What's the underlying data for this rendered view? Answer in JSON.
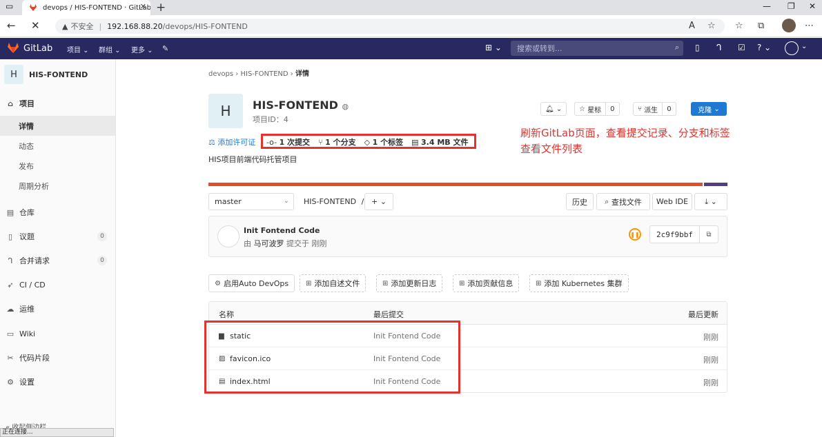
{
  "browser": {
    "tab_title": "devops / HIS-FONTEND · GitLab",
    "tab_close": "✕",
    "new_tab": "+",
    "security_label": "不安全",
    "url_host": "192.168.88.20",
    "url_path": "/devops/HIS-FONTEND",
    "status_text": "正在连接..."
  },
  "header": {
    "brand": "GitLab",
    "menu_projects": "项目",
    "menu_groups": "群组",
    "menu_more": "更多",
    "search_placeholder": "搜索或转到..."
  },
  "sidebar": {
    "project_avatar": "H",
    "project_name": "HIS-FONTEND",
    "items": [
      {
        "label": "项目",
        "icon": "home-icon"
      },
      {
        "label": "仓库",
        "icon": "doc-icon"
      },
      {
        "label": "议题",
        "icon": "issues-icon",
        "badge": "0"
      },
      {
        "label": "合并请求",
        "icon": "merge-icon",
        "badge": "0"
      },
      {
        "label": "CI / CD",
        "icon": "rocket-icon"
      },
      {
        "label": "运维",
        "icon": "cloud-icon"
      },
      {
        "label": "Wiki",
        "icon": "book-icon"
      },
      {
        "label": "代码片段",
        "icon": "scissors-icon"
      },
      {
        "label": "设置",
        "icon": "gear-icon"
      }
    ],
    "subitems": [
      {
        "label": "详情"
      },
      {
        "label": "动态"
      },
      {
        "label": "发布"
      },
      {
        "label": "周期分析"
      }
    ],
    "collapse_label": "收起侧边栏"
  },
  "breadcrumb": {
    "group": "devops",
    "project": "HIS-FONTEND",
    "current": "详情"
  },
  "project": {
    "avatar": "H",
    "title": "HIS-FONTEND",
    "id_label": "项目ID：4",
    "star_label": "星标",
    "star_count": "0",
    "fork_label": "派生",
    "fork_count": "0",
    "clone_label": "克隆",
    "license_link": "添加许可证",
    "commits": "1 次提交",
    "branches": "1 个分支",
    "tags": "1 个标签",
    "size": "3.4 MB 文件",
    "description": "HIS项目前端代码托管项目",
    "language_share": [
      0.95,
      0.05
    ]
  },
  "annotation": {
    "line1": "刷新GitLab页面，查看提交记录、分支和标签",
    "line2": "查看文件列表"
  },
  "repo_toolbar": {
    "branch": "master",
    "path": "HIS-FONTEND",
    "separator": "/",
    "history": "历史",
    "find_file": "查找文件",
    "web_ide": "Web IDE"
  },
  "last_commit": {
    "title": "Init Fontend Code",
    "by": "由",
    "author": "马可波罗",
    "submitted": "提交于",
    "time": "刚刚",
    "sha": "2c9f9bbf"
  },
  "actions": [
    "启用Auto DevOps",
    "添加自述文件",
    "添加更新日志",
    "添加贡献信息",
    "添加 Kubernetes 集群"
  ],
  "files": {
    "headers": {
      "name": "名称",
      "last_commit": "最后提交",
      "last_update": "最后更新"
    },
    "rows": [
      {
        "name": "static",
        "icon": "folder-icon",
        "commit": "Init Fontend Code",
        "updated": "刚刚"
      },
      {
        "name": "favicon.ico",
        "icon": "image-file-icon",
        "commit": "Init Fontend Code",
        "updated": "刚刚"
      },
      {
        "name": "index.html",
        "icon": "file-icon",
        "commit": "Init Fontend Code",
        "updated": "刚刚"
      }
    ]
  },
  "colors": {
    "header_bg": "#292961",
    "annotation_red": "#e5322d",
    "clone_blue": "#1f78d1",
    "lang_html": "#e44d26",
    "lang_css": "#563d7c"
  }
}
